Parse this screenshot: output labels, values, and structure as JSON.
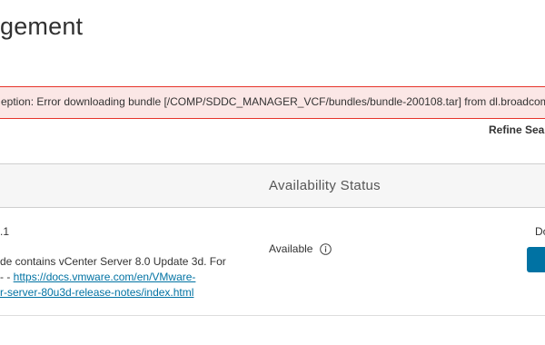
{
  "page": {
    "title": "gement"
  },
  "error_banner": {
    "message": "eption: Error downloading bundle [/COMP/SDDC_MANAGER_VCF/bundles/bundle-200108.tar] from dl.broadcom.com"
  },
  "toolbar": {
    "refine_search_label": "Refine Search"
  },
  "table": {
    "columns": {
      "availability_status": "Availability Status"
    },
    "rows": [
      {
        "version_fragment": ".1",
        "description_line1": "de contains vCenter Server 8.0 Update 3d. For",
        "description_line2_prefix": "- - ",
        "description_link_part1": "https://docs.vmware.com/en/VMware-",
        "description_link_part2": "r-server-80u3d-release-notes/index.html",
        "availability": "Available",
        "status_fragment": "Do"
      }
    ]
  },
  "colors": {
    "error_border": "#e6342b",
    "error_background": "#fbe7e6",
    "link": "#0072a3",
    "primary_button": "#0072a3",
    "header_background": "#f6f6f6"
  },
  "icons": {
    "availability_info": "info-circle-icon"
  }
}
